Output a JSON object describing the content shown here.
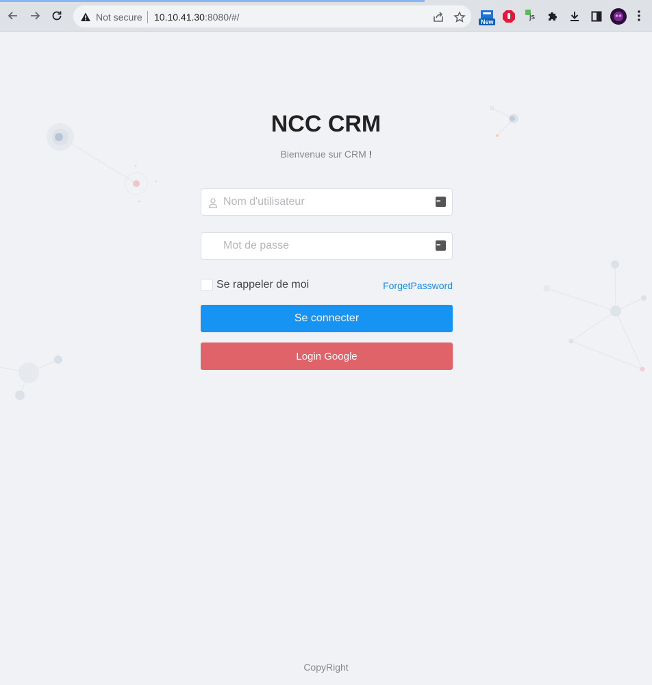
{
  "browser": {
    "security_label": "Not secure",
    "url_host": "10.10.41.30",
    "url_rest": ":8080/#/",
    "extensions": [
      "new-badge-extension-icon",
      "adblock-extension-icon",
      "js-extension-icon",
      "puzzle-extensions-icon",
      "download-icon",
      "sidepanel-icon",
      "profile-avatar-icon"
    ],
    "new_badge_label": "New",
    "js_label": "js"
  },
  "login": {
    "title": "NCC CRM",
    "subtitle": "Bienvenue sur CRM",
    "subtitle_mark": "!",
    "username_placeholder": "Nom d'utilisateur",
    "password_placeholder": "Mot de passe",
    "remember_label": "Se rappeler de moi",
    "forget_label": "ForgetPassword",
    "login_button": "Se connecter",
    "google_button": "Login Google"
  },
  "footer": {
    "copyright": "CopyRight"
  },
  "colors": {
    "primary": "#1693f3",
    "google": "#e0636a",
    "link": "#1a8ae6",
    "background": "#f0f2f5"
  }
}
